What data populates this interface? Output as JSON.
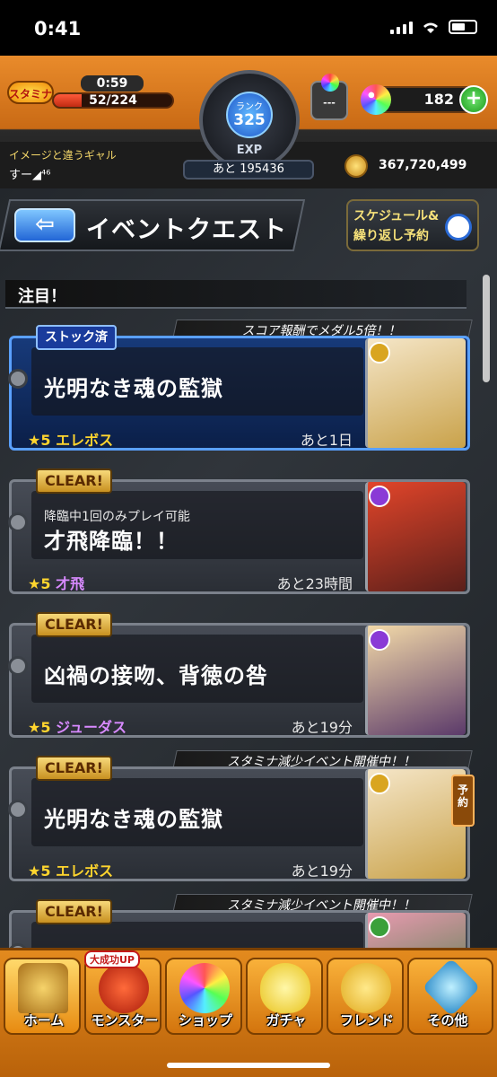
{
  "status": {
    "time": "0:41"
  },
  "header": {
    "stamina_label": "スタミナ",
    "stamina_timer": "0:59",
    "stamina_value": "52/224",
    "stamina_fraction": 0.232,
    "rank_label": "ランク",
    "rank_value": "325",
    "exp_label": "EXP",
    "exp_remaining": "あと 195436",
    "orb_machine_text": "---",
    "orb_count": "182",
    "player_name": "イメージと違うギャル",
    "player_sub": "すー◢⁴⁶",
    "coins": "367,720,499"
  },
  "title_bar": {
    "title": "イベントクエスト",
    "schedule_line1": "スケジュール&",
    "schedule_line2": "繰り返し予約"
  },
  "section": {
    "title": "注目！"
  },
  "quests": [
    {
      "tag": "ストック済",
      "banner": "スコア報酬でメダル5倍！！",
      "note": "",
      "name": "光明なき魂の監獄",
      "boss_star": "★5",
      "boss_name": "エレボス",
      "remaining": "あと1日",
      "element_color": "#d9a520",
      "portrait_colors": [
        "#f5e6c8",
        "#c9a24a"
      ]
    },
    {
      "tag": "CLEAR!",
      "banner": "",
      "note": "降臨中1回のみプレイ可能",
      "name": "才飛降臨！！",
      "boss_star": "★5",
      "boss_name": "才飛",
      "remaining": "あと23時間",
      "element_color": "#8a3ad6",
      "portrait_colors": [
        "#e2452a",
        "#5a1f1a"
      ]
    },
    {
      "tag": "CLEAR!",
      "banner": "",
      "note": "",
      "name": "凶禍の接吻、背徳の咎",
      "boss_star": "★5",
      "boss_name": "ジューダス",
      "remaining": "あと19分",
      "element_color": "#8a3ad6",
      "portrait_colors": [
        "#f2d9a8",
        "#5b3a6a"
      ]
    },
    {
      "tag": "CLEAR!",
      "banner": "スタミナ減少イベント開催中！！",
      "note": "",
      "name": "光明なき魂の監獄",
      "boss_star": "★5",
      "boss_name": "エレボス",
      "remaining": "あと19分",
      "element_color": "#d9a520",
      "portrait_colors": [
        "#f5e6c8",
        "#c9a24a"
      ],
      "reserve_label": "予約"
    },
    {
      "tag": "CLEAR!",
      "banner": "スタミナ減少イベント開催中！！",
      "note": "",
      "name": "",
      "boss_star": "",
      "boss_name": "",
      "remaining": "",
      "element_color": "#3aa03a",
      "portrait_colors": [
        "#e89ab0",
        "#3a7a3a"
      ]
    }
  ],
  "bottom_nav": {
    "badge": "大成功UP",
    "items": [
      "ホーム",
      "モンスター",
      "ショップ",
      "ガチャ",
      "フレンド",
      "その他"
    ]
  }
}
